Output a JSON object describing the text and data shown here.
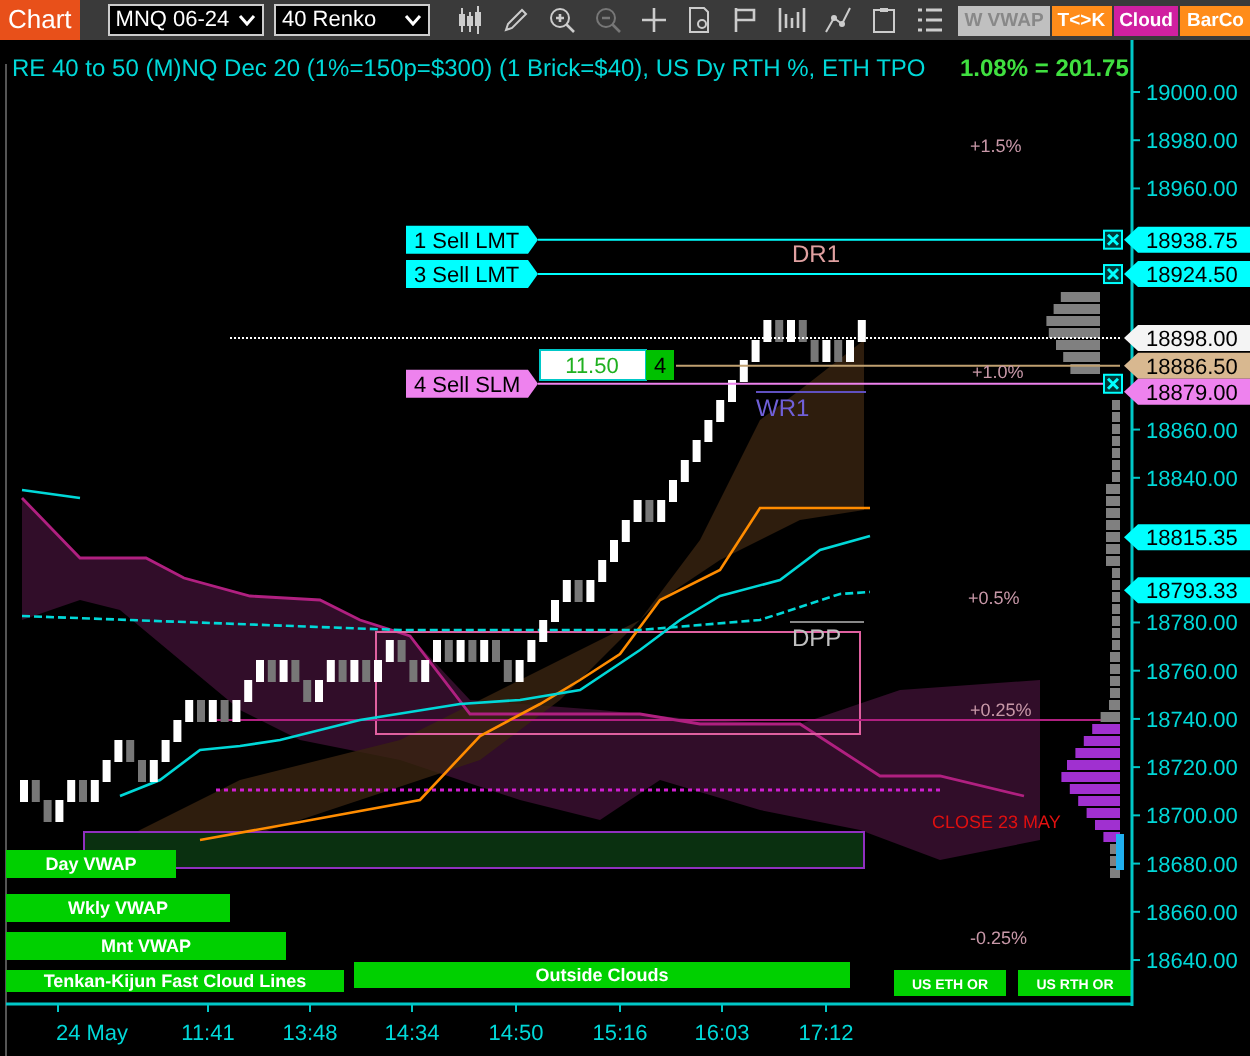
{
  "toolbar": {
    "title": "Chart",
    "instrument": "MNQ 06-24",
    "bar_type": "40 Renko",
    "buttons": [
      {
        "label": "W VWAP",
        "color": "#c0c0c0"
      },
      {
        "label": "T<>K",
        "color": "#ff8c1a"
      },
      {
        "label": "Cloud",
        "color": "#d020a0"
      },
      {
        "label": "BarCo",
        "color": "#ff8c1a"
      }
    ]
  },
  "chart": {
    "header": "RE 40 to 50 (M)NQ Dec 20 (1%=150p=$300) (1 Brick=$40), US Dy RTH %, ETH TPO",
    "readout": "1.08% = 201.75",
    "price_axis": [
      "19000.00",
      "18980.00",
      "18960.00",
      "18860.00",
      "18840.00",
      "18780.00",
      "18760.00",
      "18740.00",
      "18720.00",
      "18700.00",
      "18680.00",
      "18660.00",
      "18640.00"
    ],
    "price_markers": [
      {
        "text": "18938.75",
        "color": "#00ffff"
      },
      {
        "text": "18924.50",
        "color": "#00ffff"
      },
      {
        "text": "18898.00",
        "color": "#f4f4f4"
      },
      {
        "text": "18886.50",
        "color": "#d8b890"
      },
      {
        "text": "18879.00",
        "color": "#ee82ee"
      },
      {
        "text": "18815.35",
        "color": "#00ffff"
      },
      {
        "text": "18793.33",
        "color": "#00ffff"
      }
    ],
    "orders": [
      {
        "label": "1 Sell LMT",
        "color": "#00ffff"
      },
      {
        "label": "3 Sell LMT",
        "color": "#00ffff"
      },
      {
        "label": "4 Sell SLM",
        "color": "#ee82ee"
      }
    ],
    "position": {
      "pnl": "11.50",
      "quantity": "4"
    },
    "levels": [
      {
        "text": "+1.5%",
        "color": "#c898a8"
      },
      {
        "text": "DR1",
        "color": "#e0a0a0"
      },
      {
        "text": "+1.0%",
        "color": "#c898a8"
      },
      {
        "text": "WR1",
        "color": "#7060d8"
      },
      {
        "text": "+0.5%",
        "color": "#c898a8"
      },
      {
        "text": "DPP",
        "color": "#c0c0c0"
      },
      {
        "text": "+0.25%",
        "color": "#c898a8"
      },
      {
        "text": "CLOSE 23 MAY",
        "color": "#e01010"
      },
      {
        "text": "-0.25%",
        "color": "#c898a8"
      }
    ],
    "indicator_labels": [
      "Day VWAP",
      "Wkly VWAP",
      "Mnt VWAP",
      "Tenkan-Kijun Fast Cloud Lines",
      "Outside Clouds",
      "US ETH OR",
      "US RTH OR"
    ],
    "time_axis": [
      "24 May",
      "11:41",
      "13:48",
      "14:34",
      "14:50",
      "15:16",
      "16:03",
      "17:12"
    ]
  }
}
